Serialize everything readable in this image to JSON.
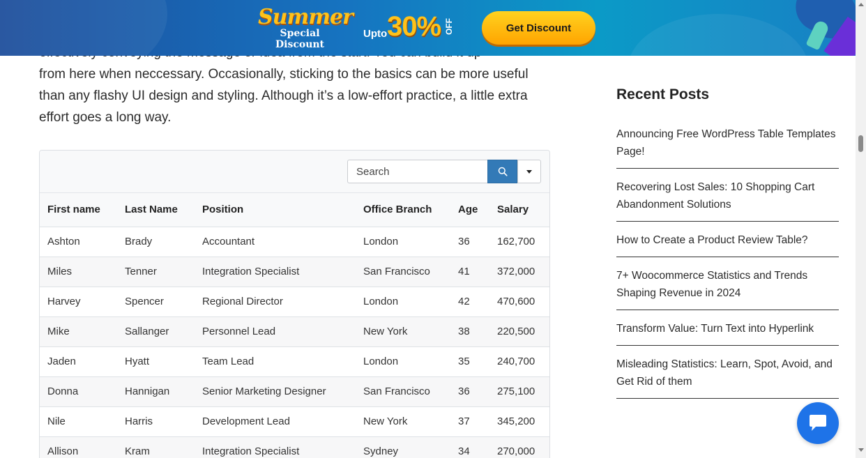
{
  "banner": {
    "summer": "Summer",
    "special": "Special Discount",
    "upto": "Upto",
    "percent": "30%",
    "off": "OFF",
    "cta": "Get Discount",
    "colors": {
      "bg": "#1673c0",
      "accent": "#ffc21a",
      "cta": "#ffb300"
    }
  },
  "article": {
    "partial_line": "effectively conveying the message or idea from the start. You can build it up",
    "paragraph": "from here when neccessary. Occasionally, sticking to the basics can be more useful than any flashy UI design and styling. Although it’s a low-effort practice, a little extra effort goes a long way."
  },
  "table": {
    "search_placeholder": "Search",
    "search_icon": "search-icon",
    "columns": [
      "First name",
      "Last Name",
      "Position",
      "Office Branch",
      "Age",
      "Salary"
    ],
    "rows": [
      [
        "Ashton",
        "Brady",
        "Accountant",
        "London",
        "36",
        "162,700"
      ],
      [
        "Miles",
        "Tenner",
        "Integration Specialist",
        "San Francisco",
        "41",
        "372,000"
      ],
      [
        "Harvey",
        "Spencer",
        "Regional Director",
        "London",
        "42",
        "470,600"
      ],
      [
        "Mike",
        "Sallanger",
        "Personnel Lead",
        "New York",
        "38",
        "220,500"
      ],
      [
        "Jaden",
        "Hyatt",
        "Team Lead",
        "London",
        "35",
        "240,700"
      ],
      [
        "Donna",
        "Hannigan",
        "Senior Marketing Designer",
        "San Francisco",
        "36",
        "275,100"
      ],
      [
        "Nile",
        "Harris",
        "Development Lead",
        "New York",
        "37",
        "345,200"
      ],
      [
        "Allison",
        "Kram",
        "Integration Specialist",
        "Sydney",
        "34",
        "270,000"
      ]
    ]
  },
  "sidebar": {
    "title": "Recent Posts",
    "posts": [
      "Announcing Free WordPress Table Templates Page!",
      "Recovering Lost Sales: 10 Shopping Cart Abandonment Solutions",
      "How to Create a Product Review Table?",
      "7+ Woocommerce Statistics and Trends Shaping Revenue in 2024",
      "Transform Value: Turn Text into Hyperlink",
      "Misleading Statistics: Learn, Spot, Avoid, and Get Rid of them"
    ]
  },
  "chat": {
    "icon": "chat-bubble-icon",
    "color": "#1e73e8"
  }
}
